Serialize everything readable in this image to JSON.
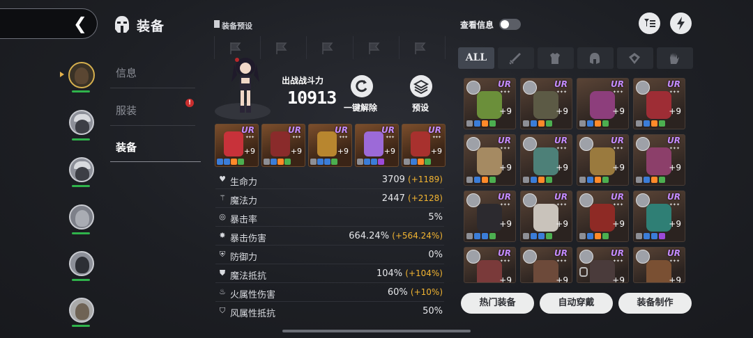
{
  "header": {
    "title": "装备",
    "preset_label": "装备预设"
  },
  "side_nav": {
    "items": [
      {
        "label": "信息",
        "active": false
      },
      {
        "label": "服装",
        "active": false,
        "badge": "!"
      },
      {
        "label": "装备",
        "active": true
      }
    ]
  },
  "character": {
    "power_label": "出战战斗力",
    "power_value": "10913",
    "unequip_label": "一键解除",
    "preset_button_label": "预设"
  },
  "equipped_slots": [
    {
      "rarity": "UR",
      "level": "+9",
      "color": "#c8323a"
    },
    {
      "rarity": "UR",
      "level": "+9",
      "color": "#8a2b2b"
    },
    {
      "rarity": "UR",
      "level": "+9",
      "color": "#b8862f"
    },
    {
      "rarity": "UR",
      "level": "+9",
      "color": "#9c6ad8"
    },
    {
      "rarity": "UR",
      "level": "+9",
      "color": "#a8312e"
    }
  ],
  "stats": [
    {
      "icon": "heart-icon",
      "name": "生命力",
      "value": "3709",
      "bonus": "(+1189)"
    },
    {
      "icon": "wand-icon",
      "name": "魔法力",
      "value": "2447",
      "bonus": "(+2128)"
    },
    {
      "icon": "crit-icon",
      "name": "暴击率",
      "value": "5%",
      "bonus": ""
    },
    {
      "icon": "crit-damage-icon",
      "name": "暴击伤害",
      "value": "664.24%",
      "bonus": "(+564.24%)"
    },
    {
      "icon": "shield-icon",
      "name": "防御力",
      "value": "0%",
      "bonus": ""
    },
    {
      "icon": "magic-shield-icon",
      "name": "魔法抵抗",
      "value": "104%",
      "bonus": "(+104%)"
    },
    {
      "icon": "fire-icon",
      "name": "火属性伤害",
      "value": "60%",
      "bonus": "(+10%)"
    },
    {
      "icon": "wind-shield-icon",
      "name": "风属性抵抗",
      "value": "50%",
      "bonus": ""
    }
  ],
  "right_panel": {
    "view_info_label": "查看信息",
    "tabs": [
      {
        "label": "ALL",
        "icon": ""
      },
      {
        "label": "",
        "icon": "sword-icon"
      },
      {
        "label": "",
        "icon": "armor-icon"
      },
      {
        "label": "",
        "icon": "helmet-icon"
      },
      {
        "label": "",
        "icon": "accessory-icon"
      },
      {
        "label": "",
        "icon": "glove-icon"
      }
    ],
    "inventory": [
      {
        "rarity": "UR",
        "level": "+9",
        "color": "#6b8f3a"
      },
      {
        "rarity": "UR",
        "level": "+9",
        "color": "#5c5a45"
      },
      {
        "rarity": "UR",
        "level": "+9",
        "color": "#8d3e7c"
      },
      {
        "rarity": "UR",
        "level": "+9",
        "color": "#9e2d35"
      },
      {
        "rarity": "UR",
        "level": "+9",
        "color": "#a58a62"
      },
      {
        "rarity": "UR",
        "level": "+9",
        "color": "#4d8078"
      },
      {
        "rarity": "UR",
        "level": "+9",
        "color": "#9a7a3e"
      },
      {
        "rarity": "UR",
        "level": "+9",
        "color": "#8c3f6a"
      },
      {
        "rarity": "UR",
        "level": "+9",
        "color": "#2c2a2f"
      },
      {
        "rarity": "UR",
        "level": "+9",
        "color": "#c9c3bb"
      },
      {
        "rarity": "UR",
        "level": "+9",
        "color": "#8e2a25"
      },
      {
        "rarity": "UR",
        "level": "+9",
        "color": "#2f7f75"
      },
      {
        "rarity": "UR",
        "level": "+9",
        "color": "#7a3a3a"
      },
      {
        "rarity": "UR",
        "level": "+9",
        "color": "#6d4a3a"
      },
      {
        "rarity": "UR",
        "level": "+9",
        "color": "#4a3b3b"
      },
      {
        "rarity": "UR",
        "level": "+9",
        "color": "#7a5033"
      }
    ],
    "buttons": {
      "hot": "热门装备",
      "auto": "自动穿戴",
      "craft": "装备制作"
    }
  },
  "colors": {
    "accent_gold": "#f2b431",
    "rarity_ur": "#c58cff",
    "hp_green": "#2fb34b"
  }
}
